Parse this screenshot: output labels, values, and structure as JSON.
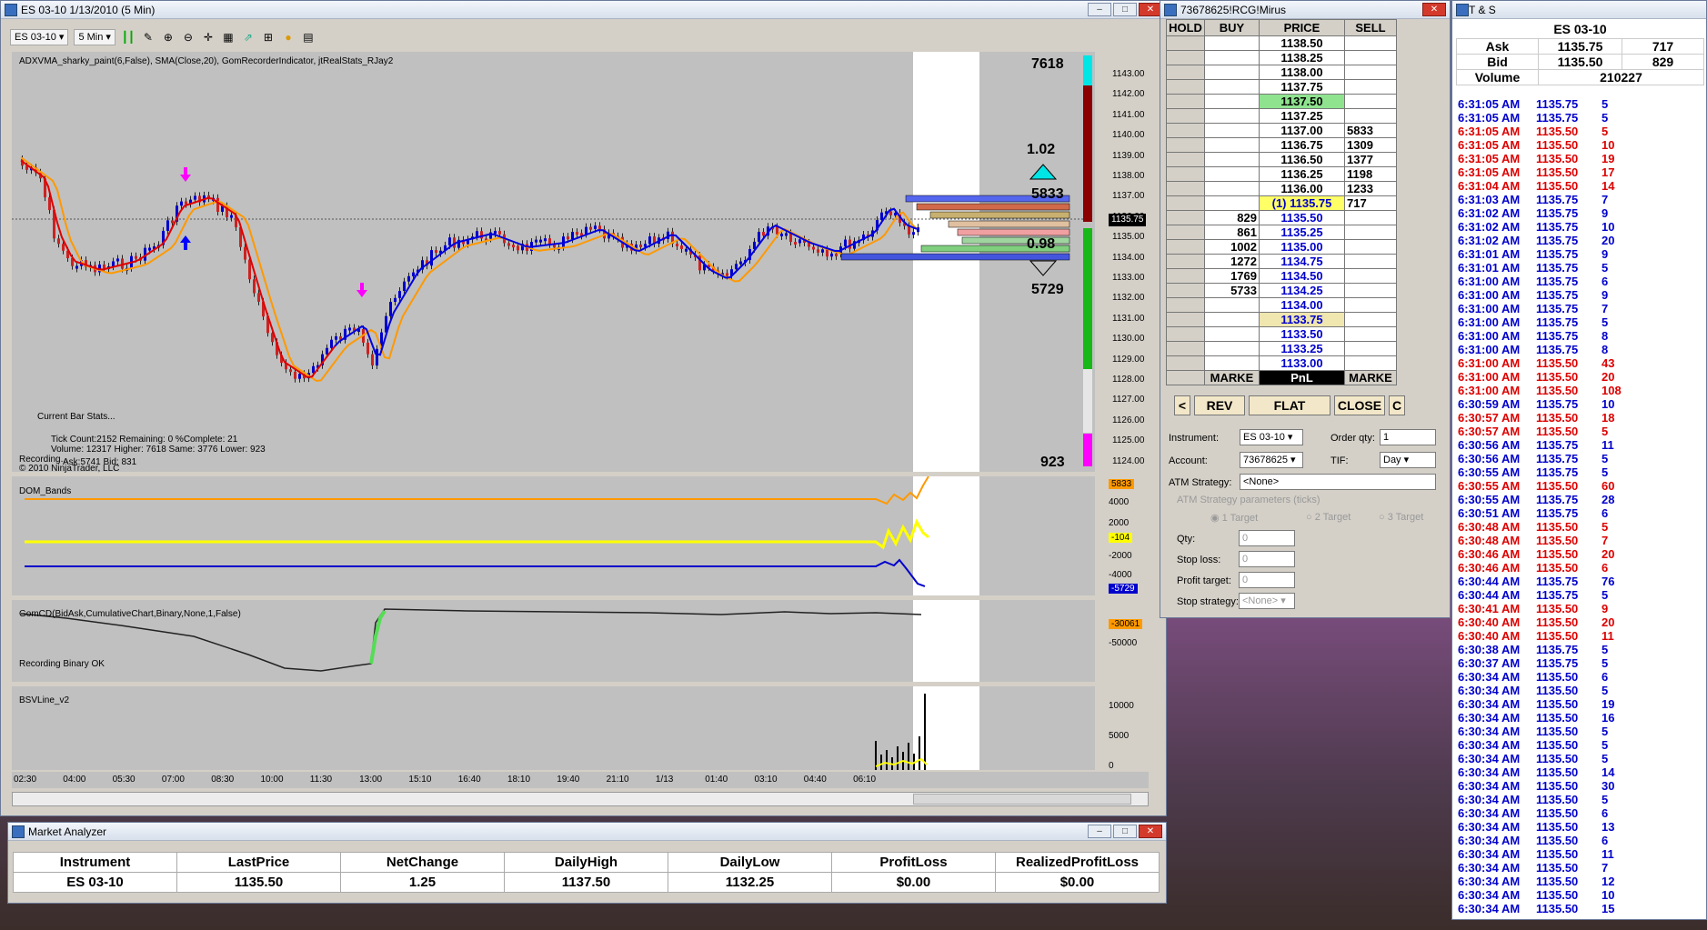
{
  "chart_window": {
    "title": "ES 03-10  1/13/2010 (5 Min)",
    "instrument": "ES 03-10",
    "period": "5 Min"
  },
  "price_panel": {
    "indicators_label": "ADXVMA_sharky_paint(6,False), SMA(Close,20), GomRecorderIndicator, jtRealStats_RJay2",
    "stats_title": "Current Bar Stats...",
    "stats_line1": "Tick Count:2152  Remaining: 0  %Complete: 21",
    "stats_line2": "Volume: 12317  Higher: 7618  Same: 3776  Lower: 923",
    "recording": "Recording...",
    "copyright": "© 2010 NinjaTrader, LLC",
    "ask_label": "Ask:5741 Bid: 831",
    "top_count": "7618",
    "ratio_up": "1.02",
    "up_count": "5833",
    "ratio_down": "0.98",
    "down_count": "5729",
    "bottom_count": "923",
    "last_price_tag": "1135.75",
    "ticks": [
      "1143.00",
      "1142.00",
      "1141.00",
      "1140.00",
      "1139.00",
      "1138.00",
      "1137.00",
      "1136.00",
      "1135.00",
      "1134.00",
      "1133.00",
      "1132.00",
      "1131.00",
      "1130.00",
      "1129.00",
      "1128.00",
      "1127.00",
      "1126.00",
      "1125.00",
      "1124.00"
    ]
  },
  "dom_bands_panel": {
    "label": "DOM_Bands",
    "ticks": [
      "4000",
      "2000",
      "-2000",
      "-4000"
    ],
    "tags": [
      "5833",
      "-104",
      "-5729"
    ]
  },
  "gom_panel": {
    "label": "GomCD(BidAsk,CumulativeChart,Binary,None,1,False)",
    "status": "Recording Binary OK",
    "ticks": [
      "-50000"
    ],
    "tag": "-30061"
  },
  "bsv_panel": {
    "label": "BSVLine_v2",
    "ticks": [
      "10000",
      "5000",
      "0"
    ]
  },
  "time_axis": [
    "02:30",
    "04:00",
    "05:30",
    "07:00",
    "08:30",
    "10:00",
    "11:30",
    "13:00",
    "15:10",
    "16:40",
    "18:10",
    "19:40",
    "21:10",
    "1/13",
    "01:40",
    "03:10",
    "04:40",
    "06:10"
  ],
  "dom_window": {
    "title": "73678625!RCG!Mirus",
    "headers": [
      "HOLD",
      "BUY",
      "PRICE",
      "SELL"
    ],
    "rows": [
      {
        "buy": "",
        "price": "1138.50",
        "sell": ""
      },
      {
        "buy": "",
        "price": "1138.25",
        "sell": ""
      },
      {
        "buy": "",
        "price": "1138.00",
        "sell": ""
      },
      {
        "buy": "",
        "price": "1137.75",
        "sell": ""
      },
      {
        "buy": "",
        "price": "1137.50",
        "sell": ""
      },
      {
        "buy": "",
        "price": "1137.25",
        "sell": ""
      },
      {
        "buy": "",
        "price": "1137.00",
        "sell": "5833"
      },
      {
        "buy": "",
        "price": "1136.75",
        "sell": "1309"
      },
      {
        "buy": "",
        "price": "1136.50",
        "sell": "1377"
      },
      {
        "buy": "",
        "price": "1136.25",
        "sell": "1198"
      },
      {
        "buy": "",
        "price": "1136.00",
        "sell": "1233"
      },
      {
        "buy": "",
        "price": "(1) 1135.75",
        "sell": "717"
      },
      {
        "buy": "829",
        "price": "1135.50",
        "sell": ""
      },
      {
        "buy": "861",
        "price": "1135.25",
        "sell": ""
      },
      {
        "buy": "1002",
        "price": "1135.00",
        "sell": ""
      },
      {
        "buy": "1272",
        "price": "1134.75",
        "sell": ""
      },
      {
        "buy": "1769",
        "price": "1134.50",
        "sell": ""
      },
      {
        "buy": "5733",
        "price": "1134.25",
        "sell": ""
      },
      {
        "buy": "",
        "price": "1134.00",
        "sell": ""
      },
      {
        "buy": "",
        "price": "1133.75",
        "sell": ""
      },
      {
        "buy": "",
        "price": "1133.50",
        "sell": ""
      },
      {
        "buy": "",
        "price": "1133.25",
        "sell": ""
      },
      {
        "buy": "",
        "price": "1133.00",
        "sell": ""
      }
    ],
    "footer": [
      "MARKE",
      "PnL",
      "MARKE"
    ],
    "buttons": [
      "<",
      "REV",
      "FLAT",
      "CLOSE",
      "C"
    ],
    "form": {
      "instrument_label": "Instrument:",
      "instrument": "ES 03-10",
      "order_qty_label": "Order qty:",
      "order_qty": "1",
      "account_label": "Account:",
      "account": "73678625",
      "tif_label": "TIF:",
      "tif": "Day",
      "atm_label": "ATM Strategy:",
      "atm": "<None>",
      "atm_params": "ATM Strategy parameters (ticks)",
      "t1": "1 Target",
      "t2": "2 Target",
      "t3": "3 Target",
      "qty_label": "Qty:",
      "qty": "0",
      "stop_label": "Stop loss:",
      "stop": "0",
      "profit_label": "Profit target:",
      "profit": "0",
      "stop_strat_label": "Stop strategy:",
      "stop_strat": "<None>"
    }
  },
  "ts_window": {
    "title": "T & S",
    "instrument": "ES 03-10",
    "ask_label": "Ask",
    "ask": "1135.75",
    "ask_size": "717",
    "bid_label": "Bid",
    "bid": "1135.50",
    "bid_size": "829",
    "volume_label": "Volume",
    "volume": "210227",
    "rows": [
      [
        "6:31:05 AM",
        "1135.75",
        "5",
        "b"
      ],
      [
        "6:31:05 AM",
        "1135.75",
        "5",
        "b"
      ],
      [
        "6:31:05 AM",
        "1135.50",
        "5",
        "r"
      ],
      [
        "6:31:05 AM",
        "1135.50",
        "10",
        "r"
      ],
      [
        "6:31:05 AM",
        "1135.50",
        "19",
        "r"
      ],
      [
        "6:31:05 AM",
        "1135.50",
        "17",
        "r"
      ],
      [
        "6:31:04 AM",
        "1135.50",
        "14",
        "r"
      ],
      [
        "6:31:03 AM",
        "1135.75",
        "7",
        "b"
      ],
      [
        "6:31:02 AM",
        "1135.75",
        "9",
        "b"
      ],
      [
        "6:31:02 AM",
        "1135.75",
        "10",
        "b"
      ],
      [
        "6:31:02 AM",
        "1135.75",
        "20",
        "b"
      ],
      [
        "6:31:01 AM",
        "1135.75",
        "9",
        "b"
      ],
      [
        "6:31:01 AM",
        "1135.75",
        "5",
        "b"
      ],
      [
        "6:31:00 AM",
        "1135.75",
        "6",
        "b"
      ],
      [
        "6:31:00 AM",
        "1135.75",
        "9",
        "b"
      ],
      [
        "6:31:00 AM",
        "1135.75",
        "7",
        "b"
      ],
      [
        "6:31:00 AM",
        "1135.75",
        "5",
        "b"
      ],
      [
        "6:31:00 AM",
        "1135.75",
        "8",
        "b"
      ],
      [
        "6:31:00 AM",
        "1135.75",
        "8",
        "b"
      ],
      [
        "6:31:00 AM",
        "1135.50",
        "43",
        "r"
      ],
      [
        "6:31:00 AM",
        "1135.50",
        "20",
        "r"
      ],
      [
        "6:31:00 AM",
        "1135.50",
        "108",
        "r"
      ],
      [
        "6:30:59 AM",
        "1135.75",
        "10",
        "b"
      ],
      [
        "6:30:57 AM",
        "1135.50",
        "18",
        "r"
      ],
      [
        "6:30:57 AM",
        "1135.50",
        "5",
        "r"
      ],
      [
        "6:30:56 AM",
        "1135.75",
        "11",
        "b"
      ],
      [
        "6:30:56 AM",
        "1135.75",
        "5",
        "b"
      ],
      [
        "6:30:55 AM",
        "1135.75",
        "5",
        "b"
      ],
      [
        "6:30:55 AM",
        "1135.50",
        "60",
        "r"
      ],
      [
        "6:30:55 AM",
        "1135.75",
        "28",
        "b"
      ],
      [
        "6:30:51 AM",
        "1135.75",
        "6",
        "b"
      ],
      [
        "6:30:48 AM",
        "1135.50",
        "5",
        "r"
      ],
      [
        "6:30:48 AM",
        "1135.50",
        "7",
        "r"
      ],
      [
        "6:30:46 AM",
        "1135.50",
        "20",
        "r"
      ],
      [
        "6:30:46 AM",
        "1135.50",
        "6",
        "r"
      ],
      [
        "6:30:44 AM",
        "1135.75",
        "76",
        "b"
      ],
      [
        "6:30:44 AM",
        "1135.75",
        "5",
        "b"
      ],
      [
        "6:30:41 AM",
        "1135.50",
        "9",
        "r"
      ],
      [
        "6:30:40 AM",
        "1135.50",
        "20",
        "r"
      ],
      [
        "6:30:40 AM",
        "1135.50",
        "11",
        "r"
      ],
      [
        "6:30:38 AM",
        "1135.75",
        "5",
        "b"
      ],
      [
        "6:30:37 AM",
        "1135.75",
        "5",
        "b"
      ],
      [
        "6:30:34 AM",
        "1135.50",
        "6",
        "b"
      ],
      [
        "6:30:34 AM",
        "1135.50",
        "5",
        "b"
      ],
      [
        "6:30:34 AM",
        "1135.50",
        "19",
        "b"
      ],
      [
        "6:30:34 AM",
        "1135.50",
        "16",
        "b"
      ],
      [
        "6:30:34 AM",
        "1135.50",
        "5",
        "b"
      ],
      [
        "6:30:34 AM",
        "1135.50",
        "5",
        "b"
      ],
      [
        "6:30:34 AM",
        "1135.50",
        "5",
        "b"
      ],
      [
        "6:30:34 AM",
        "1135.50",
        "14",
        "b"
      ],
      [
        "6:30:34 AM",
        "1135.50",
        "30",
        "b"
      ],
      [
        "6:30:34 AM",
        "1135.50",
        "5",
        "b"
      ],
      [
        "6:30:34 AM",
        "1135.50",
        "6",
        "b"
      ],
      [
        "6:30:34 AM",
        "1135.50",
        "13",
        "b"
      ],
      [
        "6:30:34 AM",
        "1135.50",
        "6",
        "b"
      ],
      [
        "6:30:34 AM",
        "1135.50",
        "11",
        "b"
      ],
      [
        "6:30:34 AM",
        "1135.50",
        "7",
        "b"
      ],
      [
        "6:30:34 AM",
        "1135.50",
        "12",
        "b"
      ],
      [
        "6:30:34 AM",
        "1135.50",
        "10",
        "b"
      ],
      [
        "6:30:34 AM",
        "1135.50",
        "15",
        "b"
      ]
    ]
  },
  "market_analyzer": {
    "title": "Market Analyzer",
    "headers": [
      "Instrument",
      "LastPrice",
      "NetChange",
      "DailyHigh",
      "DailyLow",
      "ProfitLoss",
      "RealizedProfitLoss"
    ],
    "values": [
      "ES 03-10",
      "1135.50",
      "1.25",
      "1137.50",
      "1132.25",
      "$0.00",
      "$0.00"
    ]
  },
  "colors": {
    "buy_blue": "#0000cc",
    "sell_red": "#dd0000",
    "highlight_green": "#8fe38f",
    "highlight_yellow": "#ffff66",
    "highlight_tan": "#efe6b0"
  }
}
